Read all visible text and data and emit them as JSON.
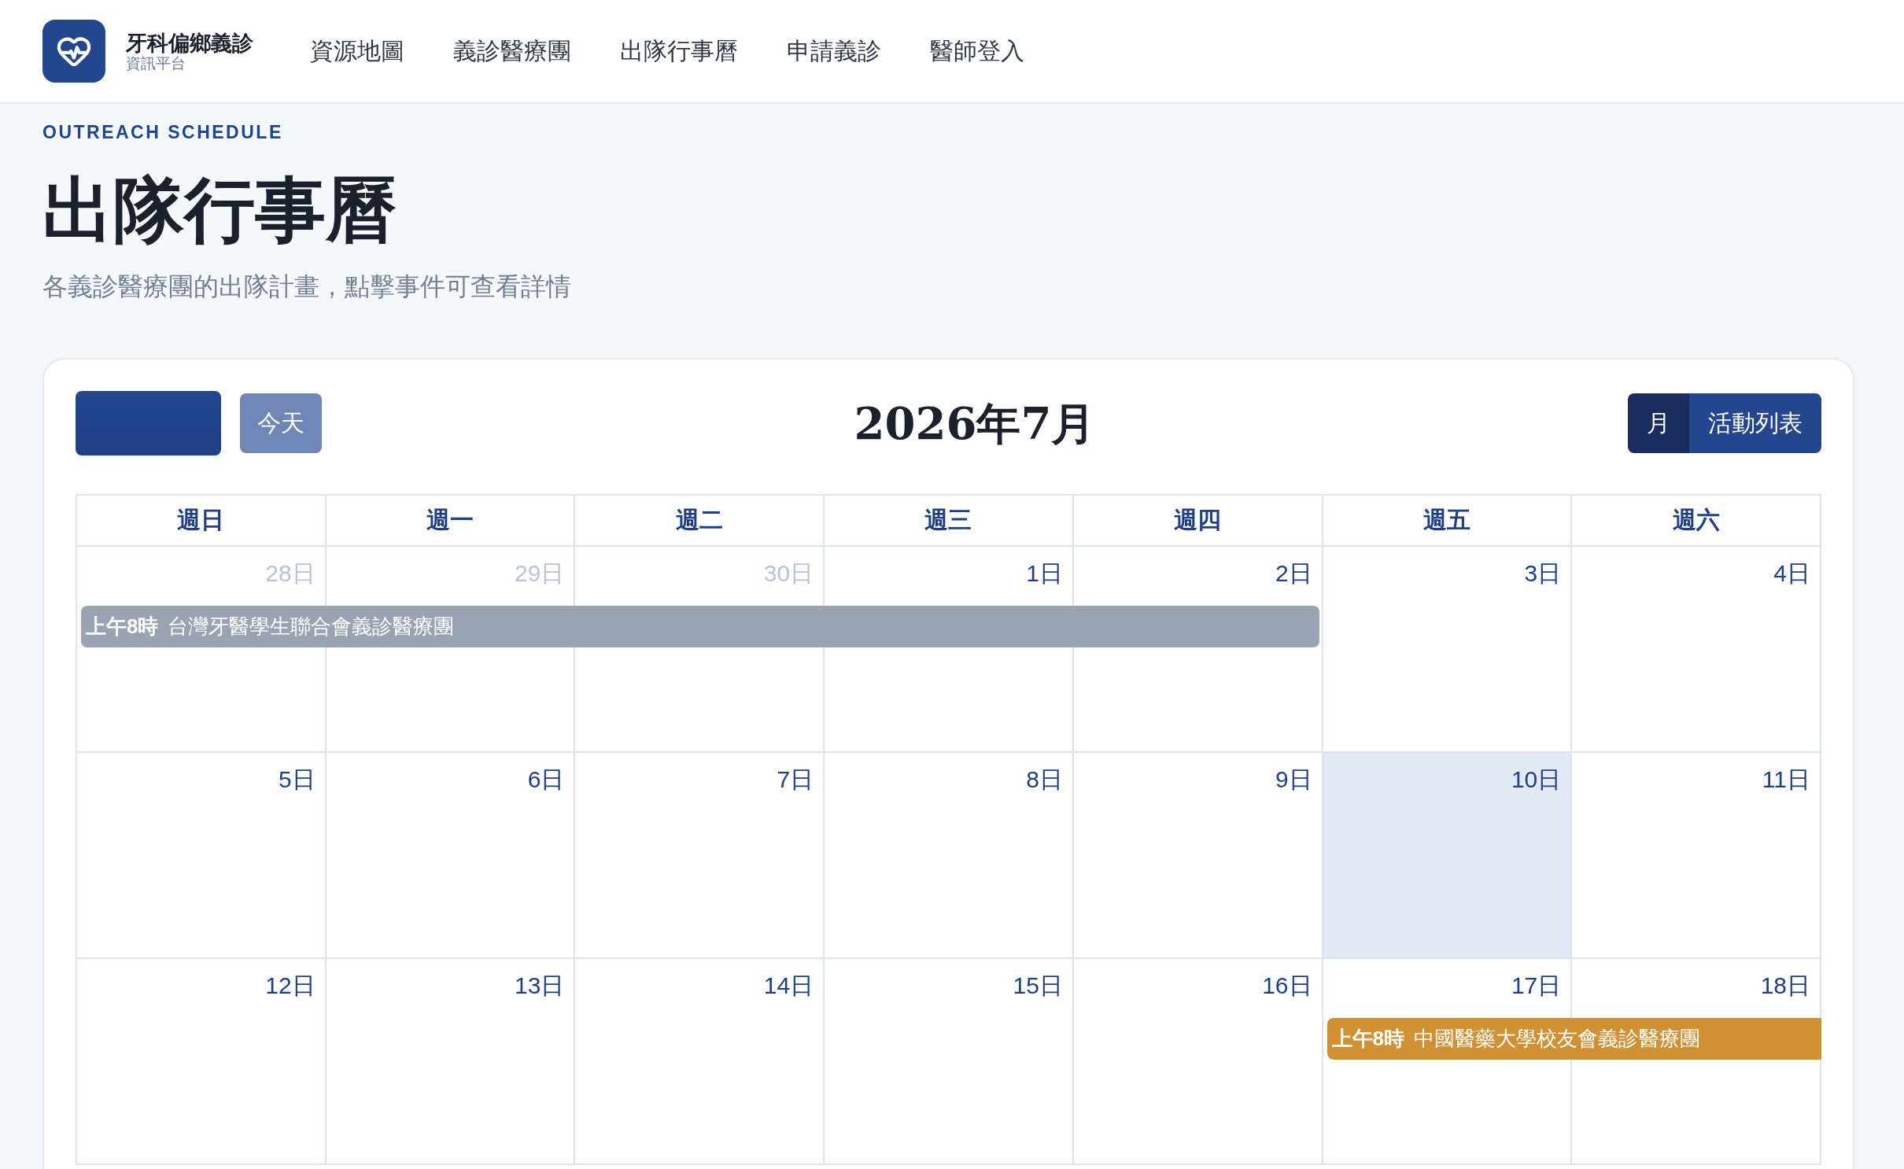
{
  "header": {
    "brand": {
      "title": "牙科偏鄉義診",
      "subtitle": "資訊平台"
    },
    "nav": [
      "資源地圖",
      "義診醫療團",
      "出隊行事曆",
      "申請義診",
      "醫師登入"
    ]
  },
  "page": {
    "eyebrow": "OUTREACH SCHEDULE",
    "title": "出隊行事曆",
    "description": "各義診醫療團的出隊計畫，點擊事件可查看詳情"
  },
  "calendar": {
    "today_button": {
      "label": "今天",
      "disabled": true
    },
    "title": "2026年7月",
    "views": [
      {
        "label": "月",
        "selected": true
      },
      {
        "label": "活動列表",
        "selected": false
      }
    ],
    "weekdays": [
      "週日",
      "週一",
      "週二",
      "週三",
      "週四",
      "週五",
      "週六"
    ],
    "weeks": [
      {
        "days": [
          {
            "label": "28日",
            "other_month": true,
            "today": false
          },
          {
            "label": "29日",
            "other_month": true,
            "today": false
          },
          {
            "label": "30日",
            "other_month": true,
            "today": false
          },
          {
            "label": "1日",
            "other_month": false,
            "today": false
          },
          {
            "label": "2日",
            "other_month": false,
            "today": false
          },
          {
            "label": "3日",
            "other_month": false,
            "today": false
          },
          {
            "label": "4日",
            "other_month": false,
            "today": false
          }
        ],
        "event_slots": [
          {
            "kind": "event",
            "time": "上午8時",
            "title": "台灣牙醫學生聯合會義診醫療團",
            "color": "#9aa3b1",
            "continues_next_week": false
          },
          {
            "kind": "continued"
          },
          {
            "kind": "continued"
          },
          {
            "kind": "continued"
          },
          {
            "kind": "continued"
          },
          {
            "kind": "free"
          },
          {
            "kind": "free"
          }
        ]
      },
      {
        "days": [
          {
            "label": "5日",
            "other_month": false,
            "today": false
          },
          {
            "label": "6日",
            "other_month": false,
            "today": false
          },
          {
            "label": "7日",
            "other_month": false,
            "today": false
          },
          {
            "label": "8日",
            "other_month": false,
            "today": false
          },
          {
            "label": "9日",
            "other_month": false,
            "today": false
          },
          {
            "label": "10日",
            "other_month": false,
            "today": true
          },
          {
            "label": "11日",
            "other_month": false,
            "today": false
          }
        ]
      },
      {
        "days": [
          {
            "label": "12日",
            "other_month": false,
            "today": false
          },
          {
            "label": "13日",
            "other_month": false,
            "today": false
          },
          {
            "label": "14日",
            "other_month": false,
            "today": false
          },
          {
            "label": "15日",
            "other_month": false,
            "today": false
          },
          {
            "label": "16日",
            "other_month": false,
            "today": false
          },
          {
            "label": "17日",
            "other_month": false,
            "today": false
          },
          {
            "label": "18日",
            "other_month": false,
            "today": false
          }
        ],
        "event_slots": [
          {
            "kind": "free"
          },
          {
            "kind": "free"
          },
          {
            "kind": "free"
          },
          {
            "kind": "free"
          },
          {
            "kind": "free"
          },
          {
            "kind": "event",
            "time": "上午8時",
            "title": "中國醫藥大學校友會義診醫療團",
            "color": "#cf9133",
            "continues_next_week": true
          },
          {
            "kind": "continued"
          }
        ]
      }
    ]
  }
}
